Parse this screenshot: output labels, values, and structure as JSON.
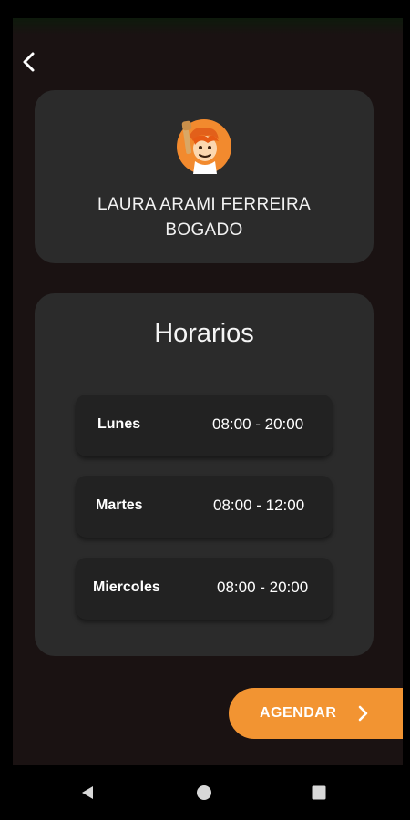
{
  "header": {
    "back_icon": "chevron-left-icon"
  },
  "profile": {
    "avatar_icon": "avatar-illustration",
    "name_line1": "LAURA ARAMI FERREIRA",
    "name_line2": "BOGADO"
  },
  "schedule": {
    "title": "Horarios",
    "rows": [
      {
        "day": "Lunes",
        "hours": "08:00 - 20:00"
      },
      {
        "day": "Martes",
        "hours": "08:00 - 12:00"
      },
      {
        "day": "Miercoles",
        "hours": "08:00 - 20:00"
      }
    ]
  },
  "action": {
    "label": "AGENDAR",
    "icon": "chevron-right-icon"
  },
  "navigation": {
    "back": "triangle-back-icon",
    "home": "circle-home-icon",
    "recents": "square-recents-icon"
  },
  "colors": {
    "background": "#1a1212",
    "card": "#2b2b2b",
    "row": "#222222",
    "accent": "#f29432"
  }
}
